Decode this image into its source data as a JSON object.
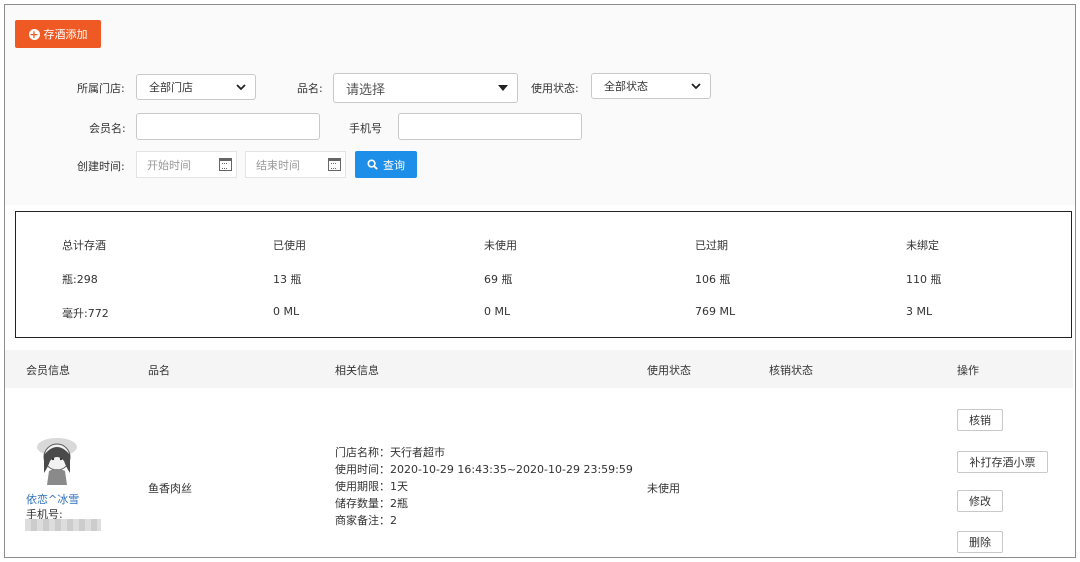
{
  "toolbar": {
    "add_label": "存酒添加"
  },
  "filters": {
    "store_label": "所属门店:",
    "store_value": "全部门店",
    "product_label": "品名:",
    "product_placeholder": "请选择",
    "status_label": "使用状态:",
    "status_value": "全部状态",
    "member_label": "会员名:",
    "phone_label": "手机号",
    "created_label": "创建时间:",
    "start_placeholder": "开始时间",
    "end_placeholder": "结束时间",
    "query_label": "查询"
  },
  "stats": {
    "headers": [
      "总计存酒",
      "已使用",
      "未使用",
      "已过期",
      "未绑定"
    ],
    "bottles": [
      "瓶:298",
      "13 瓶",
      "69 瓶",
      "106 瓶",
      "110 瓶"
    ],
    "ml": [
      "毫升:772",
      "0 ML",
      "0 ML",
      "769 ML",
      "3 ML"
    ]
  },
  "table": {
    "headers": [
      "会员信息",
      "品名",
      "相关信息",
      "使用状态",
      "核销状态",
      "操作"
    ],
    "row": {
      "member_name": "依恋^冰雪",
      "phone_label": "手机号:",
      "product": "鱼香肉丝",
      "info": [
        "门店名称：天行者超市",
        "使用时间：2020-10-29 16:43:35~2020-10-29 23:59:59",
        "使用期限：1天",
        "储存数量：2瓶",
        "商家备注：2"
      ],
      "status": "未使用",
      "actions": [
        "核销",
        "补打存酒小票",
        "修改",
        "删除"
      ]
    }
  }
}
